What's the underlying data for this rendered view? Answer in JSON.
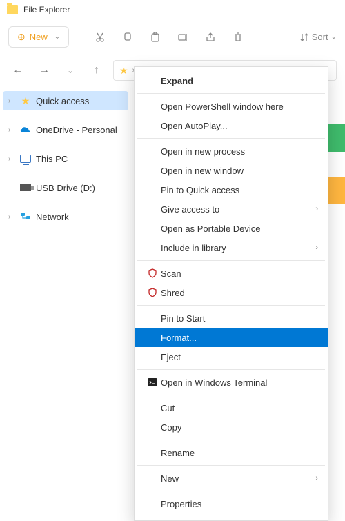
{
  "title": "File Explorer",
  "toolbar": {
    "new_label": "New",
    "sort_label": "Sort"
  },
  "tree": {
    "items": [
      {
        "label": "Quick access",
        "icon": "star",
        "selected": true
      },
      {
        "label": "OneDrive - Personal",
        "icon": "onedrive",
        "selected": false
      },
      {
        "label": "This PC",
        "icon": "pc",
        "selected": false
      },
      {
        "label": "USB Drive (D:)",
        "icon": "usb",
        "selected": false
      },
      {
        "label": "Network",
        "icon": "network",
        "selected": false
      }
    ]
  },
  "peek_colors": {
    "green": "#3fbb6c",
    "orange": "#ffb640"
  },
  "context_menu": {
    "expand": "Expand",
    "open_powershell": "Open PowerShell window here",
    "open_autoplay": "Open AutoPlay...",
    "open_new_process": "Open in new process",
    "open_new_window": "Open in new window",
    "pin_quick": "Pin to Quick access",
    "give_access": "Give access to",
    "open_portable": "Open as Portable Device",
    "include_library": "Include in library",
    "scan": "Scan",
    "shred": "Shred",
    "pin_start": "Pin to Start",
    "format": "Format...",
    "eject": "Eject",
    "open_terminal": "Open in Windows Terminal",
    "cut": "Cut",
    "copy": "Copy",
    "rename": "Rename",
    "new": "New",
    "properties": "Properties"
  }
}
